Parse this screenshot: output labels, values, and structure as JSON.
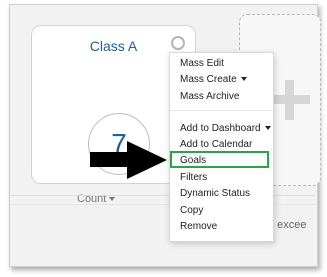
{
  "card": {
    "title": "Class A",
    "value": "7",
    "count_label": "Count"
  },
  "background": {
    "truncated_text": "t excee"
  },
  "menu": {
    "items": [
      "Mass Edit",
      "Mass Create",
      "Mass Archive",
      "Add to Dashboard",
      "Add to Calendar",
      "Goals",
      "Filters",
      "Dynamic Status",
      "Copy",
      "Remove"
    ],
    "highlighted_item": "Goals"
  },
  "colors": {
    "accent_blue": "#1f5f9e",
    "highlight_green": "#2aa34a",
    "arrow": "#000000"
  },
  "icons": [
    "gear-icon",
    "plus-icon",
    "chevron-down-icon",
    "pointer-arrow-icon"
  ]
}
